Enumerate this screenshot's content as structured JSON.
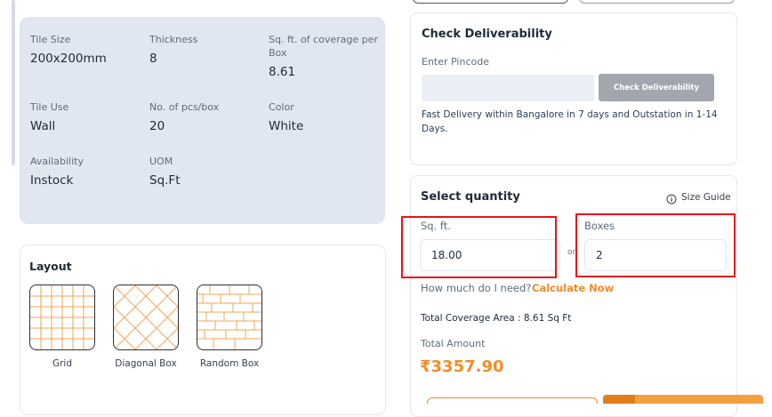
{
  "specs": {
    "tile_size": {
      "label": "Tile Size",
      "value": "200x200mm"
    },
    "thickness": {
      "label": "Thickness",
      "value": "8"
    },
    "coverage": {
      "label_line1": "Sq. ft. of coverage per",
      "label_line2": "Box",
      "value": "8.61"
    },
    "tile_use": {
      "label": "Tile Use",
      "value": "Wall"
    },
    "pcs_per_box": {
      "label": "No. of pcs/box",
      "value": "20"
    },
    "color": {
      "label": "Color",
      "value": "White"
    },
    "availability": {
      "label": "Availability",
      "value": "Instock"
    },
    "uom": {
      "label": "UOM",
      "value": "Sq.Ft"
    }
  },
  "layout": {
    "title": "Layout",
    "options": [
      {
        "label": "Grid",
        "icon": "grid-pattern-icon"
      },
      {
        "label": "Diagonal Box",
        "icon": "diagonal-pattern-icon"
      },
      {
        "label": "Random Box",
        "icon": "brick-pattern-icon"
      }
    ]
  },
  "deliverability": {
    "title": "Check Deliverability",
    "pincode_label": "Enter Pincode",
    "pincode_value": "",
    "button_label": "Check Deliverability",
    "note_line1": "Fast Delivery within Bangalore in 7 days and Outstation in 1-14",
    "note_line2": "Days."
  },
  "quantity": {
    "title": "Select quantity",
    "size_guide": "Size Guide",
    "sqft_label": "Sq. ft.",
    "sqft_value": "18.00",
    "or_text": "or",
    "boxes_label": "Boxes",
    "boxes_value": "2",
    "help_text": "How much do I need?",
    "calc_link": "Calculate Now",
    "total_coverage": "Total Coverage Area : 8.61 Sq Ft",
    "total_amount_label": "Total Amount",
    "total_amount": "₹3357.90"
  },
  "colors": {
    "accent": "#f28c28",
    "highlight": "#e5141b",
    "panel": "#e1e7f0",
    "button_disabled": "#a2a6ad"
  }
}
